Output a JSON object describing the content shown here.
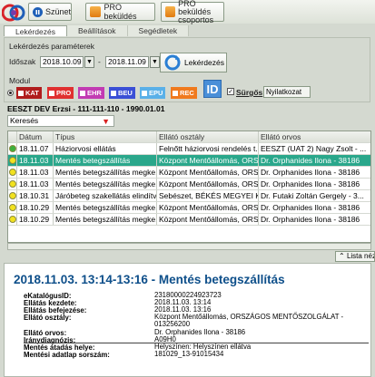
{
  "toolbar": {
    "szunet_label": "Szünet",
    "pro_bekuldes_label": "PRO beküldés",
    "pro_bekuldes_csoportos_line1": "PRO beküldés",
    "pro_bekuldes_csoportos_line2": "csoportos"
  },
  "tabs": [
    {
      "label": "Lekérdezés",
      "active": true
    },
    {
      "label": "Beállítások",
      "active": false
    },
    {
      "label": "Segédletek",
      "active": false
    }
  ],
  "query": {
    "section_title": "Lekérdezés paraméterek",
    "period_label": "Időszak",
    "date_from": "2018.10.09",
    "date_separator": "-",
    "date_to": "2018.11.09",
    "button_label": "Lekérdezés",
    "modul_label": "Modul",
    "modules": [
      {
        "label": "KAT",
        "color": "#b01d1d"
      },
      {
        "label": "PRO",
        "color": "#e03030"
      },
      {
        "label": "EHR",
        "color": "#c23bb3"
      },
      {
        "label": "BEU",
        "color": "#3a4fd6"
      },
      {
        "label": "EPU",
        "color": "#5ab0e8"
      },
      {
        "label": "REC",
        "color": "#f07a1e"
      }
    ],
    "id_badge": "ID",
    "surgos_label": "Sürgős",
    "nyilatkozat_label": "Nyilatkozat"
  },
  "patient_header": "EESZT DEV Erzsi - 111-111-110 - 1990.01.01",
  "search": {
    "label": "Keresés"
  },
  "grid": {
    "columns": [
      "",
      "Dátum",
      "Típus",
      "Ellátó osztály",
      "Ellátó orvos"
    ],
    "rows": [
      {
        "status": "green",
        "date": "18.11.07",
        "type": "Háziorvosi ellátás",
        "dept": "Felnőtt háziorvosi rendelés t...",
        "doctor": "EESZT (UAT 2) Nagy Zsolt - ...",
        "selected": false
      },
      {
        "status": "yellow",
        "date": "18.11.03",
        "type": "Mentés betegszállítás",
        "dept": "Központ Mentőállomás, ORS...",
        "doctor": "Dr. Orphanides Ilona - 38186",
        "selected": true
      },
      {
        "status": "yellow",
        "date": "18.11.03",
        "type": "Mentés betegszállítás megke...",
        "dept": "Központ Mentőállomás, ORS...",
        "doctor": "Dr. Orphanides Ilona - 38186",
        "selected": false
      },
      {
        "status": "yellow",
        "date": "18.11.03",
        "type": "Mentés betegszállítás megke...",
        "dept": "Központ Mentőállomás, ORS...",
        "doctor": "Dr. Orphanides Ilona - 38186",
        "selected": false
      },
      {
        "status": "yellow",
        "date": "18.10.31",
        "type": "Járóbeteg szakellátás elindítva",
        "dept": "Sebészet, BÉKÉS MEGYEI K...",
        "doctor": "Dr. Futaki Zoltán Gergely - 3...",
        "selected": false
      },
      {
        "status": "yellow",
        "date": "18.10.29",
        "type": "Mentés betegszállítás megke...",
        "dept": "Központ Mentőállomás, ORS...",
        "doctor": "Dr. Orphanides Ilona - 38186",
        "selected": false
      },
      {
        "status": "yellow",
        "date": "18.10.29",
        "type": "Mentés betegszállítás megke...",
        "dept": "Központ Mentőállomás, ORS...",
        "doctor": "Dr. Orphanides Ilona - 38186",
        "selected": false
      }
    ]
  },
  "list_view_label": "Lista néze",
  "detail": {
    "title": "2018.11.03. 13:14-13:16 - Mentés betegszállítás",
    "fields": [
      {
        "label": "eKatalógusID:",
        "value": "23180000224923723"
      },
      {
        "label": "Ellátás kezdete:",
        "value": "2018.11.03. 13:14"
      },
      {
        "label": "Ellátás befejezése:",
        "value": "2018.11.03. 13:16"
      },
      {
        "label": "Ellátó osztály:",
        "value": "Központ Mentőállomás, ORSZÁGOS MENTŐSZOLGÁLAT - 013256200"
      },
      {
        "label": "Ellátó orvos:",
        "value": "Dr. Orphanides Ilona - 38186"
      },
      {
        "label": "Iránydiagnózis:",
        "value": "A09H0"
      },
      {
        "label": "Mentés átadás helye:",
        "value": "Helyszínen: Helyszínen ellátva"
      },
      {
        "label": "Mentési adatlap sorszám:",
        "value": "181029_13-91015434"
      }
    ]
  },
  "colors": {
    "selected_row": "#2aa78b",
    "title_blue": "#0e4f8a",
    "status_green": "#3cb03c",
    "status_yellow": "#f2e21e"
  }
}
